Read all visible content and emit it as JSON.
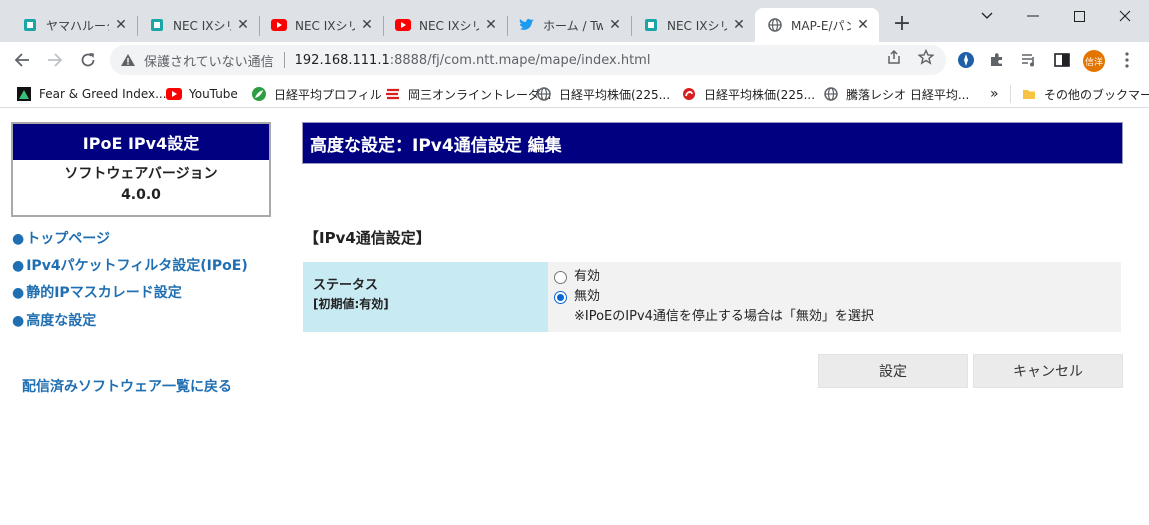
{
  "browser": {
    "tabs": [
      {
        "title": "ヤマハルーター",
        "icon": "page-icon",
        "active": false
      },
      {
        "title": "NEC IXシリー",
        "icon": "page-icon",
        "active": false
      },
      {
        "title": "NEC IXシリー",
        "icon": "youtube-icon",
        "active": false
      },
      {
        "title": "NEC IXシリー",
        "icon": "youtube-icon",
        "active": false
      },
      {
        "title": "ホーム / Twit",
        "icon": "twitter-icon",
        "active": false
      },
      {
        "title": "NEC IXシリー",
        "icon": "page-icon",
        "active": false
      },
      {
        "title": "MAP-E/パン",
        "icon": "globe-icon",
        "active": true
      }
    ],
    "address": {
      "security_label": "保護されていない通信",
      "host": "192.168.111.1",
      "path": ":8888/fj/com.ntt.mape/mape/index.html"
    },
    "profile_initials": "信洋",
    "bookmarks": [
      {
        "label": "Fear & Greed Index...",
        "icon": "chart-triangle-icon"
      },
      {
        "label": "YouTube",
        "icon": "youtube-icon"
      },
      {
        "label": "日経平均プロフィル",
        "icon": "leaf-icon"
      },
      {
        "label": "岡三オンライントレーダ...",
        "icon": "okasan-icon"
      },
      {
        "label": "日経平均株価(225...",
        "icon": "globe-icon"
      },
      {
        "label": "日経平均株価(225...",
        "icon": "swirl-icon"
      },
      {
        "label": "騰落レシオ 日経平均...",
        "icon": "globe-icon"
      }
    ],
    "more_bookmarks": "»",
    "other_bookmarks": "その他のブックマーク",
    "colors": {
      "tabbar": "#dee1e6",
      "youtube": "#ff0000",
      "twitter": "#1d9bf0",
      "page": "#1aa6a6"
    }
  },
  "sidebar": {
    "title": "IPoE IPv4設定",
    "version_label": "ソフトウェアバージョン",
    "version": "4.0.0",
    "links": [
      {
        "label": "トップページ"
      },
      {
        "label": "IPv4パケットフィルタ設定(IPoE)"
      },
      {
        "label": "静的IPマスカレード設定"
      },
      {
        "label": "高度な設定"
      }
    ],
    "bullet": "●",
    "back_link": "配信済みソフトウェア一覧に戻る"
  },
  "main": {
    "heading": "高度な設定：IPv4通信設定 編集",
    "section_title": "【IPv4通信設定】",
    "status_label": "ステータス",
    "status_default": "[初期値:有効]",
    "options": [
      {
        "label": "有効",
        "checked": false
      },
      {
        "label": "無効",
        "checked": true
      }
    ],
    "note": "※IPoEのIPv4通信を停止する場合は「無効」を選択",
    "buttons": {
      "submit": "設定",
      "cancel": "キャンセル"
    },
    "colors": {
      "header_bg": "#000080",
      "label_bg": "#c8eaf2",
      "link": "#1f6fb2"
    }
  }
}
